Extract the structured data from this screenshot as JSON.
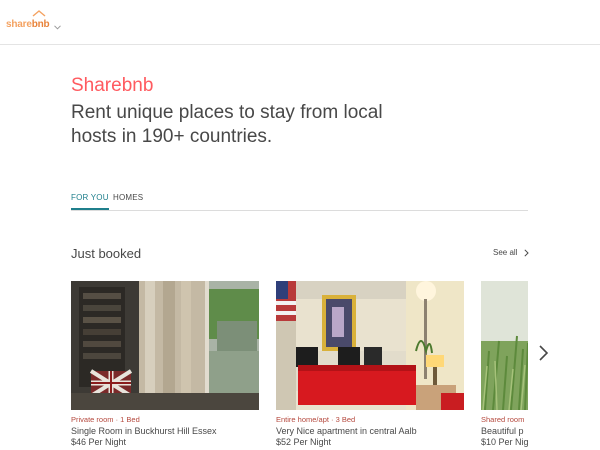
{
  "header": {
    "logo": {
      "text_main": "share",
      "text_accent": "bnb"
    }
  },
  "hero": {
    "brand": "Sharebnb",
    "tagline": "Rent unique places to stay from local hosts in 190+ countries."
  },
  "tabs": [
    {
      "label": "FOR YOU",
      "active": true
    },
    {
      "label": "HOMES",
      "active": false
    }
  ],
  "section": {
    "title": "Just booked",
    "see_all": "See all"
  },
  "listings": [
    {
      "type": "Private room · 1 Bed",
      "title": "Single Room in Buckhurst Hill Essex",
      "price": "$46 Per Night"
    },
    {
      "type": "Entire home/apt · 3 Bed",
      "title": "Very Nice apartment in central Aalb",
      "price": "$52 Per Night"
    },
    {
      "type": "Shared room",
      "title": "Beautiful p",
      "price": "$10 Per Nigh"
    }
  ],
  "colors": {
    "brand": "#ff5a5f",
    "tab_active": "#1f7f8c",
    "listing_type": "#b5493e",
    "logo": "#f4a261"
  },
  "icons": {
    "logo_roof": "house-roof-icon",
    "logo_dropdown": "chevron-down-icon",
    "see_all": "chevron-right-icon",
    "carousel_next": "chevron-right-icon"
  }
}
